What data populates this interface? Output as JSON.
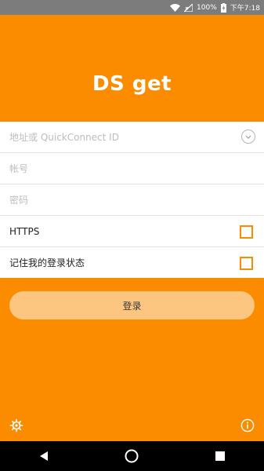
{
  "status_bar": {
    "battery": "100%",
    "time": "下午7:18",
    "icons": [
      "wifi-icon",
      "signal-icon",
      "battery-charging-icon"
    ]
  },
  "app": {
    "title": "DS get"
  },
  "form": {
    "address_placeholder": "地址或 QuickConnect ID",
    "account_placeholder": "帐号",
    "password_placeholder": "密码",
    "https_label": "HTTPS",
    "https_checked": false,
    "remember_label": "记住我的登录状态",
    "remember_checked": false
  },
  "login_button": {
    "label": "登录"
  },
  "colors": {
    "accent": "#fb8c00",
    "button_disabled": "#fdc680",
    "status_bar": "#7c7c7c",
    "nav_bar": "#000000"
  },
  "footer": {
    "icons": [
      "settings-icon",
      "info-icon"
    ]
  },
  "nav_bar": {
    "icons": [
      "back-icon",
      "home-icon",
      "recents-icon"
    ]
  }
}
